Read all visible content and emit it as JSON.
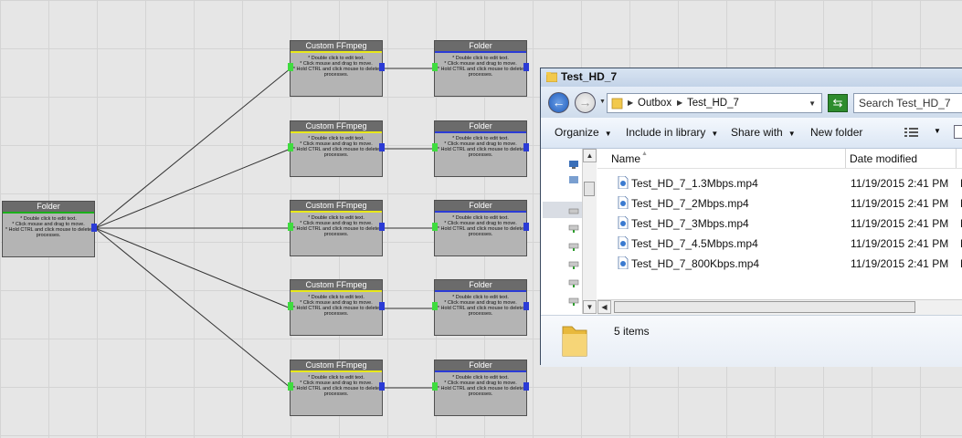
{
  "canvas": {
    "source_node": {
      "title": "Folder",
      "strip_color": "#1ab01a",
      "body": "* Double click to edit text.\n* Click mouse and drag to move.\n* Hold CTRL and click mouse to delete processes."
    },
    "ffmpeg_nodes": [
      {
        "title": "Custom FFmpeg",
        "strip_color": "#e8e81a",
        "body": "* Double click to edit text.\n* Click mouse and drag to move.\n* Hold CTRL and click mouse to delete processes."
      },
      {
        "title": "Custom FFmpeg",
        "strip_color": "#e8e81a",
        "body": "* Double click to edit text.\n* Click mouse and drag to move.\n* Hold CTRL and click mouse to delete processes."
      },
      {
        "title": "Custom FFmpeg",
        "strip_color": "#e8e81a",
        "body": "* Double click to edit text.\n* Click mouse and drag to move.\n* Hold CTRL and click mouse to delete processes."
      },
      {
        "title": "Custom FFmpeg",
        "strip_color": "#e8e81a",
        "body": "* Double click to edit text.\n* Click mouse and drag to move.\n* Hold CTRL and click mouse to delete processes."
      },
      {
        "title": "Custom FFmpeg",
        "strip_color": "#e8e81a",
        "body": "* Double click to edit text.\n* Click mouse and drag to move.\n* Hold CTRL and click mouse to delete processes."
      }
    ],
    "output_nodes": [
      {
        "title": "Folder",
        "strip_color": "#2b3bd6",
        "body": "* Double click to edit text.\n* Click mouse and drag to move.\n* Hold CTRL and click mouse to delete processes."
      },
      {
        "title": "Folder",
        "strip_color": "#2b3bd6",
        "body": "* Double click to edit text.\n* Click mouse and drag to move.\n* Hold CTRL and click mouse to delete processes."
      },
      {
        "title": "Folder",
        "strip_color": "#2b3bd6",
        "body": "* Double click to edit text.\n* Click mouse and drag to move.\n* Hold CTRL and click mouse to delete processes."
      },
      {
        "title": "Folder",
        "strip_color": "#2b3bd6",
        "body": "* Double click to edit text.\n* Click mouse and drag to move.\n* Hold CTRL and click mouse to delete processes."
      },
      {
        "title": "Folder",
        "strip_color": "#2b3bd6",
        "body": "* Double click to edit text.\n* Click mouse and drag to move.\n* Hold CTRL and click mouse to delete processes."
      }
    ]
  },
  "explorer": {
    "title": "Test_HD_7",
    "breadcrumb": [
      "Outbox",
      "Test_HD_7"
    ],
    "search_placeholder": "Search Test_HD_7",
    "commands": {
      "organize": "Organize",
      "include": "Include in library",
      "share": "Share with",
      "new_folder": "New folder"
    },
    "columns": {
      "name": "Name",
      "date": "Date modified"
    },
    "files": [
      {
        "name": "Test_HD_7_1.3Mbps.mp4",
        "date": "11/19/2015 2:41 PM",
        "extra": "M"
      },
      {
        "name": "Test_HD_7_2Mbps.mp4",
        "date": "11/19/2015 2:41 PM",
        "extra": "M"
      },
      {
        "name": "Test_HD_7_3Mbps.mp4",
        "date": "11/19/2015 2:41 PM",
        "extra": "M"
      },
      {
        "name": "Test_HD_7_4.5Mbps.mp4",
        "date": "11/19/2015 2:41 PM",
        "extra": "M"
      },
      {
        "name": "Test_HD_7_800Kbps.mp4",
        "date": "11/19/2015 2:41 PM",
        "extra": "M"
      }
    ],
    "status": "5 items",
    "colors": {
      "folder": "#f2c94c",
      "back_button": "#1e5cbd",
      "refresh": "#2e8c2e"
    }
  }
}
